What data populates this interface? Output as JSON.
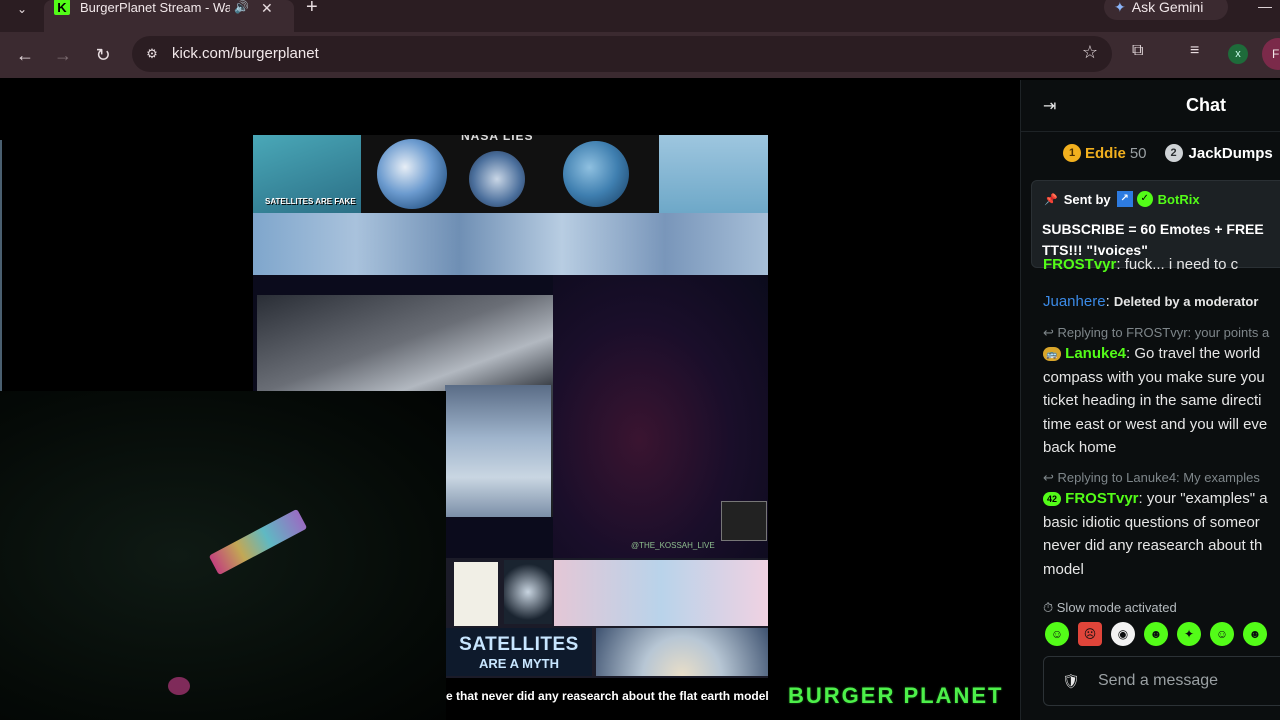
{
  "browser": {
    "tab_title": "BurgerPlanet Stream - Watch",
    "favicon_letter": "K",
    "gemini_label": "Ask Gemini",
    "url": "kick.com/burgerplanet",
    "profile_letter": "x",
    "profile2_letter": "F",
    "icons": [
      "tab-list-icon",
      "audio-icon",
      "close-icon",
      "plus-icon",
      "back-icon",
      "forward-icon",
      "reload-icon",
      "site-info-icon",
      "star-icon",
      "extensions-icon",
      "media-icon"
    ]
  },
  "video": {
    "collage_heading": "NASA LIES",
    "collage_caption": "SATELLITES ARE FAKE",
    "handle": "@THE_KOSSAH_LIVE",
    "satellites_line1": "SATELLITES",
    "satellites_line2": "ARE A MYTH",
    "ticker_text": "e that never did any reasearch about the flat earth model",
    "logo": "BURGER PLANET"
  },
  "chat": {
    "title": "Chat",
    "leaderboard": [
      {
        "rank": "1",
        "name": "Eddie",
        "count": "50"
      },
      {
        "rank": "2",
        "name": "JackDumps",
        "count": ""
      }
    ],
    "pinned": {
      "sent_by": "Sent by",
      "bot": "BotRix",
      "message": "SUBSCRIBE = 60 Emotes + FREE TTS!!! \"!voices\""
    },
    "messages": [
      {
        "user": "FROSTvyr",
        "text": "fuck... i need to c"
      },
      {
        "user": "Juanhere",
        "text": "Deleted by a moderator"
      },
      {
        "reply": "Replying to FROSTvyr: your points a",
        "user": "Lanuke4",
        "text": "Go travel the world compass with you make sure you ticket heading in the same directi time east or west and you will eve back home"
      },
      {
        "reply": "Replying to Lanuke4: My examples",
        "user": "FROSTvyr",
        "badge": "42",
        "text": "your \"examples\" a basic idiotic questions of someor never did any reasearch about th model"
      }
    ],
    "slow_mode": "Slow mode activated",
    "input_placeholder": "Send a message",
    "colors": {
      "accent": "#53fc18",
      "user_blue": "#3b8ae6",
      "user_green": "#53fc18"
    }
  }
}
